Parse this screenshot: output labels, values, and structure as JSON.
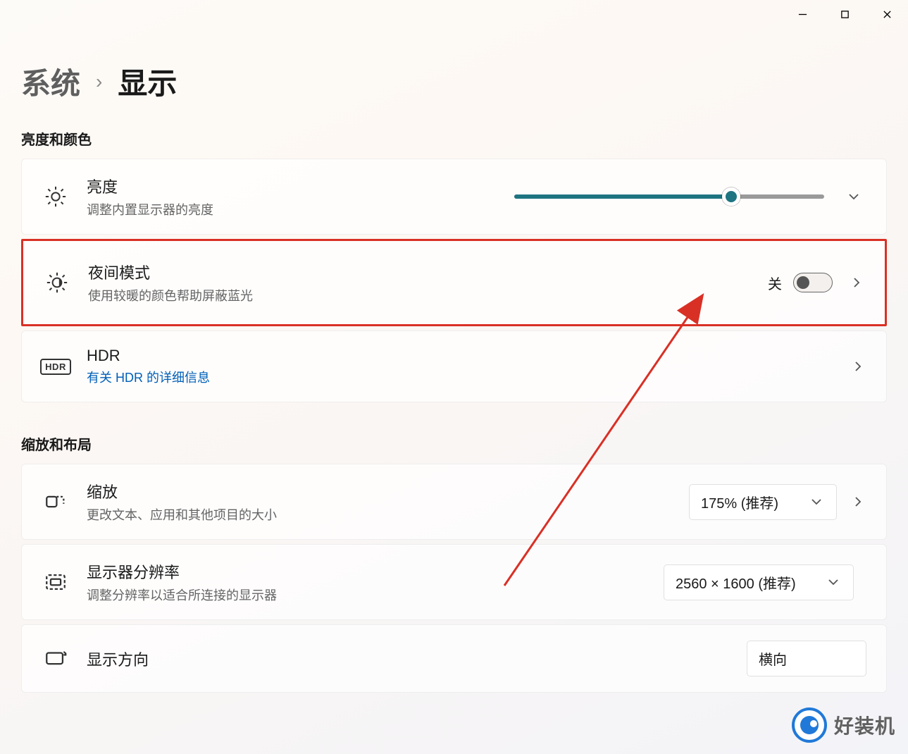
{
  "window": {
    "minimize": "−",
    "maximize": "□",
    "close": "×"
  },
  "breadcrumb": {
    "parent": "系统",
    "sep": "›",
    "current": "显示"
  },
  "sections": {
    "brightness_color": "亮度和颜色",
    "scale_layout": "缩放和布局"
  },
  "brightness": {
    "title": "亮度",
    "subtitle": "调整内置显示器的亮度",
    "value_percent": 70
  },
  "night_light": {
    "title": "夜间模式",
    "subtitle": "使用较暖的颜色帮助屏蔽蓝光",
    "toggle_label": "关",
    "toggle_on": false
  },
  "hdr": {
    "title": "HDR",
    "link": "有关 HDR 的详细信息"
  },
  "scale": {
    "title": "缩放",
    "subtitle": "更改文本、应用和其他项目的大小",
    "selected": "175% (推荐)"
  },
  "resolution": {
    "title": "显示器分辨率",
    "subtitle": "调整分辨率以适合所连接的显示器",
    "selected": "2560 × 1600 (推荐)"
  },
  "orientation": {
    "title": "显示方向",
    "selected": "横向"
  },
  "watermark": {
    "text": "好装机"
  }
}
